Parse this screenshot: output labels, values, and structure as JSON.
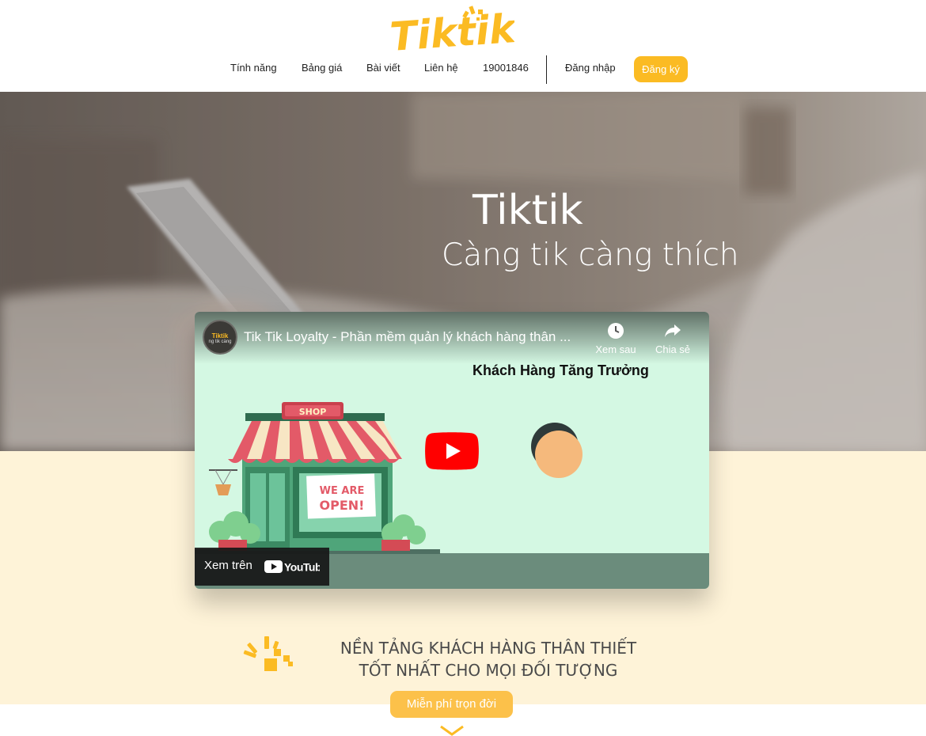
{
  "brand": {
    "logo_text": "Tiktik",
    "accent_color": "#fbbb23"
  },
  "nav": {
    "items": [
      "Tính năng",
      "Bảng giá",
      "Bài viết",
      "Liên hệ",
      "19001846"
    ],
    "login_label": "Đăng nhập",
    "signup_label": "Đăng ký"
  },
  "hero": {
    "title": "Tiktik",
    "subtitle": "Càng tik càng thích"
  },
  "video": {
    "channel_logo_text": "Tiktik",
    "channel_logo_sub": "ng tik càng",
    "title": "Tik Tik Loyalty - Phần mềm quản lý khách hàng thân ...",
    "watch_later_label": "Xem sau",
    "share_label": "Chia sẻ",
    "scene_heading": "Khách Hàng Tăng Trưởng",
    "shop_sign": "SHOP",
    "open_sign_line1": "WE ARE",
    "open_sign_line2": "OPEN!",
    "watch_on_label": "Xem trên",
    "youtube_label": "YouTube",
    "icons": [
      "clock-icon",
      "share-icon",
      "play-icon",
      "youtube-logo"
    ]
  },
  "tagline": {
    "line1": "NỀN TẢNG KHÁCH HÀNG THÂN THIẾT",
    "line2": "TỐT NHẤT CHO MỌI ĐỐI TƯỢNG"
  },
  "cta": {
    "free_label": "Miễn phí trọn đời"
  }
}
